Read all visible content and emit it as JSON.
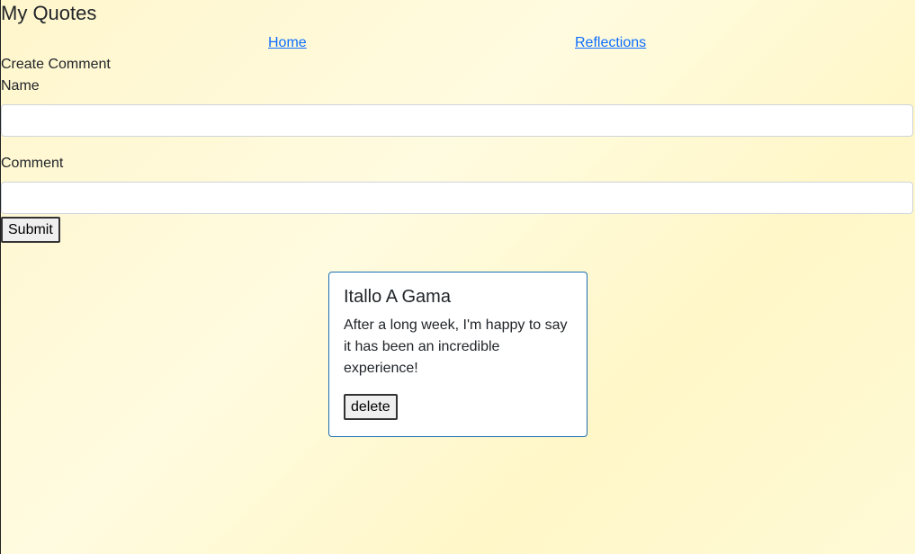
{
  "page": {
    "title": "My Quotes"
  },
  "nav": {
    "links": [
      {
        "label": "Home"
      },
      {
        "label": "Reflections"
      }
    ]
  },
  "form": {
    "heading": "Create Comment",
    "name_label": "Name",
    "name_value": "",
    "comment_label": "Comment",
    "comment_value": "",
    "submit_label": "Submit"
  },
  "comments": [
    {
      "author": "Itallo A Gama",
      "text": "After a long week, I'm happy to say it has been an incredible experience!",
      "delete_label": "delete"
    }
  ],
  "colors": {
    "link": "#0d6efd",
    "card_border": "#1a6fb0",
    "background": "#fff8d0"
  }
}
